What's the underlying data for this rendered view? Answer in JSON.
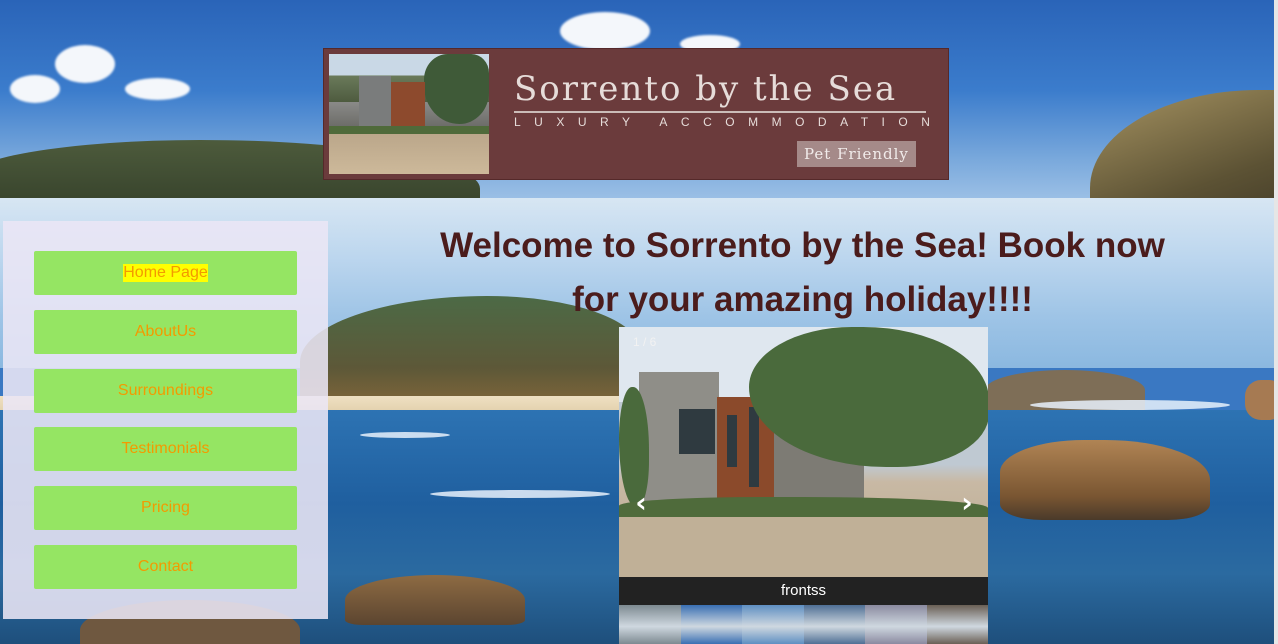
{
  "header": {
    "title": "Sorrento by the Sea",
    "subtitle": "LUXURY ACCOMMODATION",
    "badge": "Pet Friendly"
  },
  "nav": {
    "items": [
      {
        "label": "Home Page",
        "active": true
      },
      {
        "label": "AboutUs",
        "active": false
      },
      {
        "label": "Surroundings",
        "active": false
      },
      {
        "label": "Testimonials",
        "active": false
      },
      {
        "label": "Pricing",
        "active": false
      },
      {
        "label": "Contact",
        "active": false
      }
    ]
  },
  "main": {
    "heading": "Welcome to Sorrento by the Sea! Book now for your amazing holiday!!!!"
  },
  "slideshow": {
    "counter": "1 / 6",
    "caption": "frontss",
    "prev_icon": "‹",
    "next_icon": "›",
    "thumbnails": [
      {
        "color": "#7d8a91"
      },
      {
        "color": "#3a6fb3"
      },
      {
        "color": "#5e8fc2"
      },
      {
        "color": "#4f6f95"
      },
      {
        "color": "#8a8aa0"
      },
      {
        "color": "#6a5f55"
      }
    ]
  },
  "colors": {
    "banner": "#6b3b3c",
    "nav_button": "#95e563",
    "nav_text": "#f39a00",
    "active_highlight": "#ffff00",
    "heading": "#4b1c1c"
  }
}
